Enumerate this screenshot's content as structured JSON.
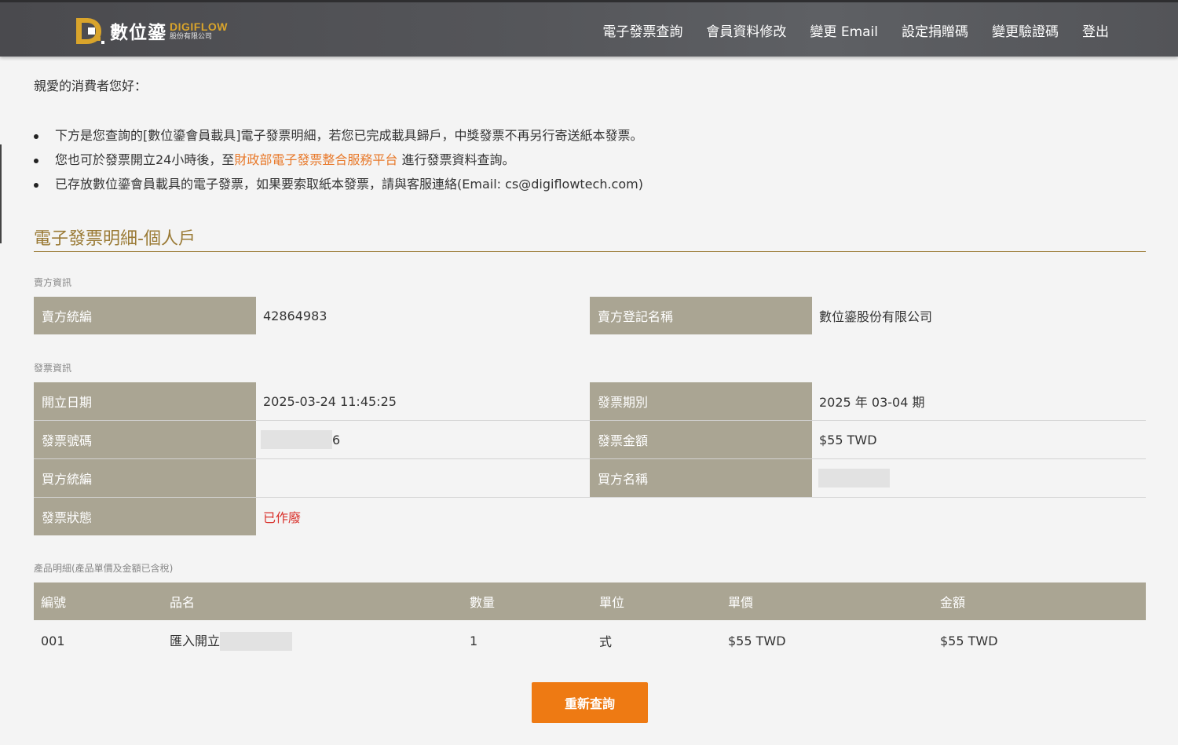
{
  "header": {
    "logo_zh": "數位鎏",
    "logo_en": "DIGIFLOW",
    "logo_company": "股份有限公司",
    "nav": [
      "電子發票查詢",
      "會員資料修改",
      "變更 Email",
      "設定捐贈碼",
      "變更驗證碼",
      "登出"
    ]
  },
  "intro": {
    "greeting": "親愛的消費者您好：",
    "bullet1": "下方是您查詢的[數位鎏會員載具]電子發票明細，若您已完成載具歸戶，中獎發票不再另行寄送紙本發票。",
    "bullet2_pre": "您也可於發票開立24小時後，至",
    "bullet2_link": "財政部電子發票整合服務平台",
    "bullet2_post": "進行發票資料查詢。",
    "bullet3": "已存放數位鎏會員載具的電子發票，如果要索取紙本發票，請與客服連絡(Email: cs@digiflowtech.com)"
  },
  "section_title": "電子發票明細-個人戶",
  "seller": {
    "label": "賣方資訊",
    "tax_id_label": "賣方統編",
    "tax_id": "42864983",
    "name_label": "賣方登記名稱",
    "name": "數位鎏股份有限公司"
  },
  "invoice": {
    "label": "發票資訊",
    "date_label": "開立日期",
    "date": "2025-03-24 11:45:25",
    "period_label": "發票期別",
    "period": "2025 年 03-04 期",
    "number_label": "發票號碼",
    "number_suffix": "6",
    "amount_label": "發票金額",
    "amount": "$55 TWD",
    "buyer_id_label": "買方統編",
    "buyer_id": "",
    "buyer_name_label": "買方名稱",
    "status_label": "發票狀態",
    "status": "已作廢"
  },
  "products": {
    "label": "產品明細(產品單價及金額已含稅)",
    "headers": [
      "編號",
      "品名",
      "數量",
      "單位",
      "單價",
      "金額"
    ],
    "rows": [
      {
        "no": "001",
        "name": "匯入開立",
        "qty": "1",
        "unit": "式",
        "price": "$55 TWD",
        "amount": "$55 TWD"
      }
    ]
  },
  "button_label": "重新查詢",
  "colors": {
    "accent": "#ee7a13",
    "label_bg": "#aaa593",
    "title": "#9a7a35",
    "status_void": "#d9312b"
  }
}
